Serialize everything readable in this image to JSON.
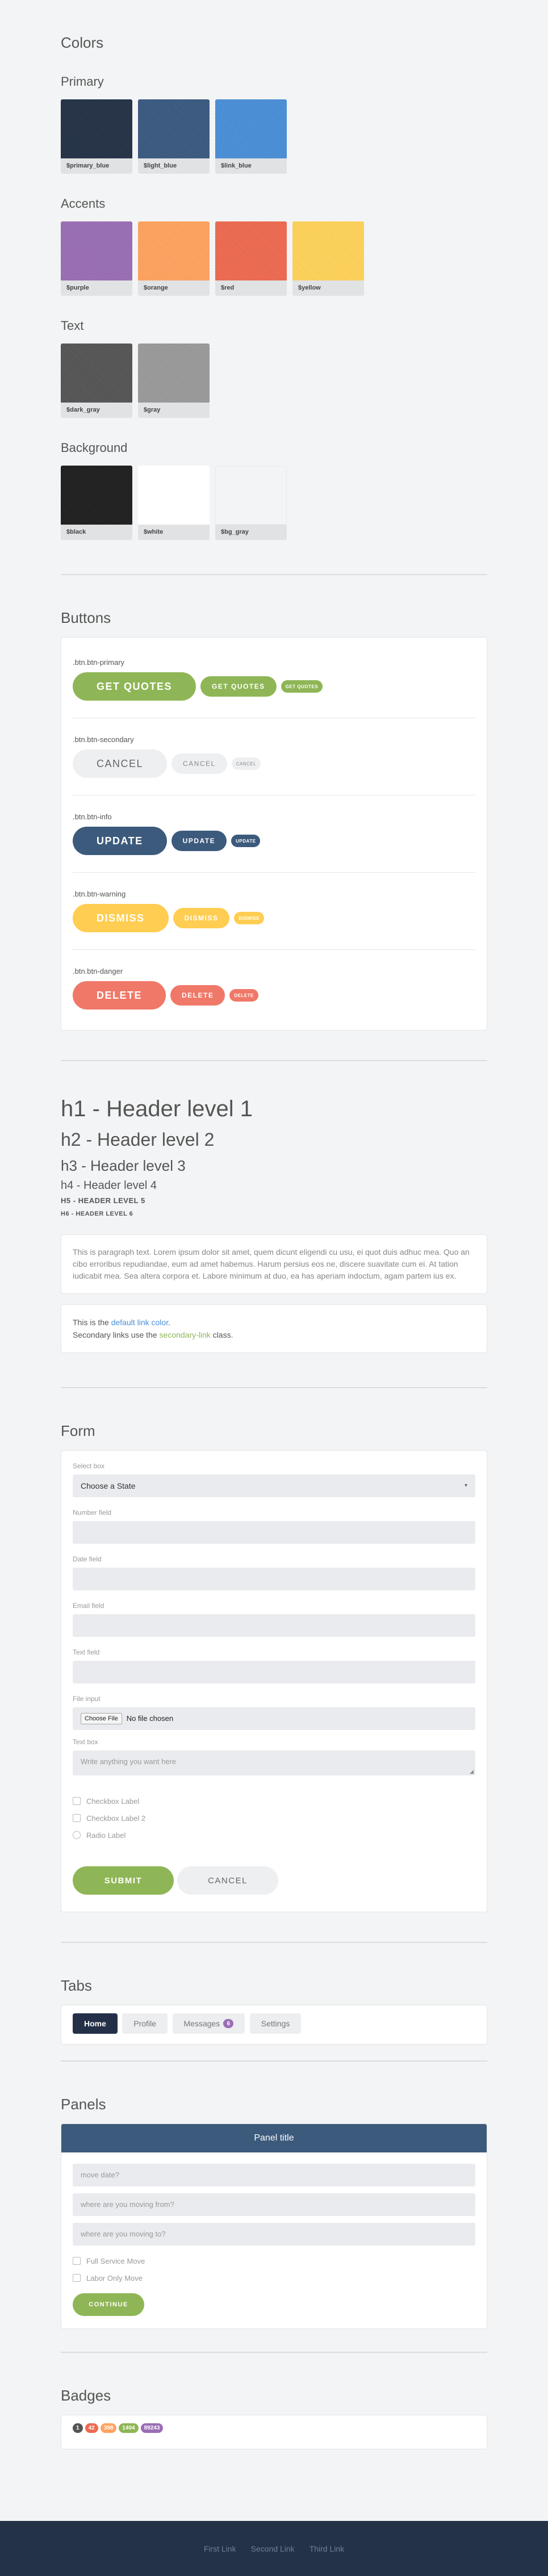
{
  "colors": {
    "title": "Colors",
    "primary": {
      "title": "Primary",
      "swatches": [
        {
          "label": "$primary_blue",
          "hex": "#243247"
        },
        {
          "label": "$light_blue",
          "hex": "#3a5a80"
        },
        {
          "label": "$link_blue",
          "hex": "#4a8fd8"
        }
      ]
    },
    "accents": {
      "title": "Accents",
      "swatches": [
        {
          "label": "$purple",
          "hex": "#9a6eb5"
        },
        {
          "label": "$orange",
          "hex": "#ffa35f"
        },
        {
          "label": "$red",
          "hex": "#ee6a50"
        },
        {
          "label": "$yellow",
          "hex": "#ffd35a"
        }
      ]
    },
    "text": {
      "title": "Text",
      "swatches": [
        {
          "label": "$dark_gray",
          "hex": "#555555"
        },
        {
          "label": "$gray",
          "hex": "#9a9a9a"
        }
      ]
    },
    "background": {
      "title": "Background",
      "swatches": [
        {
          "label": "$black",
          "hex": "#1f1f1f"
        },
        {
          "label": "$white",
          "hex": "#ffffff"
        },
        {
          "label": "$bg_gray",
          "hex": "#f3f4f5"
        }
      ]
    }
  },
  "buttons": {
    "title": "Buttons",
    "groups": [
      {
        "caption": ".btn.btn-primary",
        "label": "Get Quotes",
        "color": "#8fb656"
      },
      {
        "caption": ".btn.btn-secondary",
        "label": "Cancel",
        "color": "#eeeff1"
      },
      {
        "caption": ".btn.btn-info",
        "label": "Update",
        "color": "#3c5a7c"
      },
      {
        "caption": ".btn.btn-warning",
        "label": "Dismiss",
        "color": "#ffcd51"
      },
      {
        "caption": ".btn.btn-danger",
        "label": "Delete",
        "color": "#f07868"
      }
    ]
  },
  "typography": {
    "h1": "h1 - Header level 1",
    "h2": "h2 - Header level 2",
    "h3": "h3 - Header level 3",
    "h4": "h4 - Header level 4",
    "h5": "H5 - HEADER LEVEL 5",
    "h6": "H6 - HEADER LEVEL 6",
    "paragraph": "This is paragraph text. Lorem ipsum dolor sit amet, quem dicunt eligendi cu usu, ei quot duis adhuc mea. Quo an cibo erroribus repudiandae, eum ad amet habemus. Harum persius eos ne, discere suavitate cum ei. At tation iudicabit mea. Sea altera corpora et. Labore minimum at duo, ea has aperiam indoctum, agam partem ius ex.",
    "links": {
      "line1_prefix": "This is the ",
      "link1": "default link color",
      "line1_suffix": ".",
      "line2_prefix": "Secondary links use the ",
      "link2": "secondary-link",
      "line2_suffix": " class."
    }
  },
  "form": {
    "title": "Form",
    "select_label": "Select box",
    "select_value": "Choose a State",
    "number_label": "Number field",
    "date_label": "Date field",
    "email_label": "Email field",
    "text_label": "Text field",
    "file_label": "File input",
    "file_button": "Choose File",
    "file_status": "No file chosen",
    "textbox_label": "Text box",
    "textbox_placeholder": "Write anything you want here",
    "checkbox1": "Checkbox Label",
    "checkbox2": "Checkbox Label 2",
    "radio": "Radio Label",
    "submit": "Submit",
    "cancel": "Cancel"
  },
  "tabs": {
    "title": "Tabs",
    "items": [
      {
        "label": "Home"
      },
      {
        "label": "Profile"
      },
      {
        "label": "Messages",
        "badge": "6"
      },
      {
        "label": "Settings"
      }
    ]
  },
  "panels": {
    "title": "Panels",
    "panel_title": "Panel title",
    "fields": [
      "move date?",
      "where are you moving from?",
      "where are you moving to?"
    ],
    "check1": "Full Service Move",
    "check2": "Labor Only Move",
    "continue": "Continue"
  },
  "badges": {
    "title": "Badges",
    "items": [
      {
        "label": "1",
        "color": "#555555"
      },
      {
        "label": "42",
        "color": "#ee6a50"
      },
      {
        "label": "398",
        "color": "#ffa35f"
      },
      {
        "label": "1404",
        "color": "#8fb656"
      },
      {
        "label": "89243",
        "color": "#9a6eb5"
      }
    ]
  },
  "footer": {
    "links": [
      "First Link",
      "Second Link",
      "Third Link"
    ]
  }
}
